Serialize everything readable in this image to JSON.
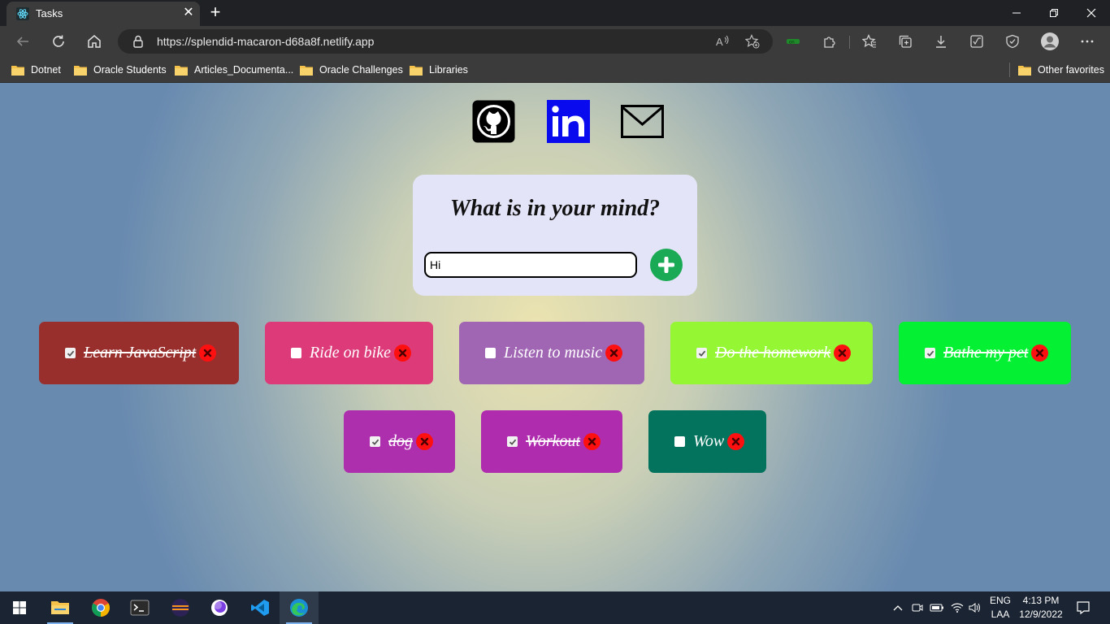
{
  "browser": {
    "tab_title": "Tasks",
    "url": "https://splendid-macaron-d68a8f.netlify.app",
    "bookmarks": [
      "Dotnet",
      "Oracle Students",
      "Articles_Documenta...",
      "Oracle Challenges",
      "Libraries"
    ],
    "other_favorites": "Other favorites"
  },
  "app": {
    "social_links": [
      "github-icon",
      "linkedin-icon",
      "mail-icon"
    ],
    "title": "What is in your mind?",
    "input_value": "Hi",
    "todos": [
      {
        "text": "Learn JavaScript",
        "done": true,
        "color": "#992f2d"
      },
      {
        "text": "Ride on bike",
        "done": false,
        "color": "#dd3a79"
      },
      {
        "text": "Listen to music",
        "done": false,
        "color": "#a066b4"
      },
      {
        "text": "Do the homework",
        "done": true,
        "color": "#95f733"
      },
      {
        "text": "Bathe my pet",
        "done": true,
        "color": "#04f133"
      },
      {
        "text": "dog",
        "done": true,
        "color": "#ad2fad"
      },
      {
        "text": "Workout",
        "done": true,
        "color": "#b02cae"
      },
      {
        "text": "Wow",
        "done": false,
        "color": "#03735d"
      }
    ]
  },
  "taskbar": {
    "language": "ENG",
    "layout": "LAA",
    "time": "4:13 PM",
    "date": "12/9/2022"
  }
}
